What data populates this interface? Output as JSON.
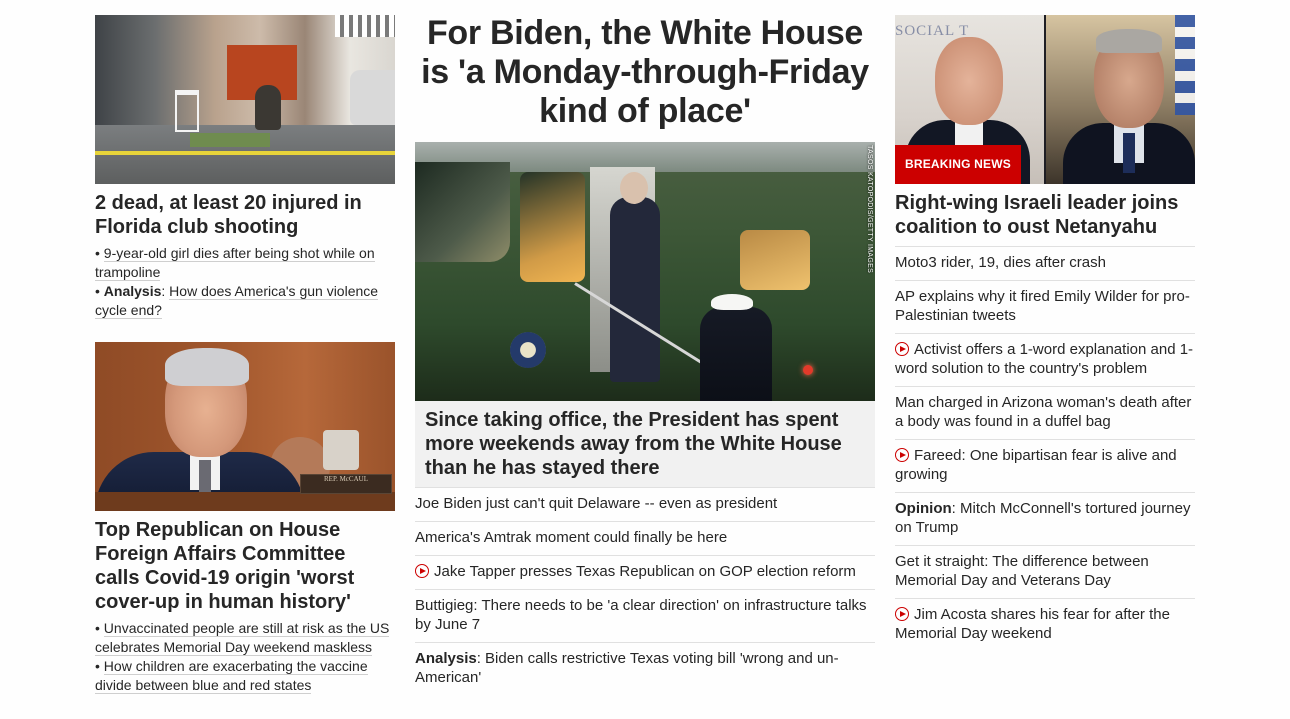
{
  "left": {
    "story1": {
      "headline": "2 dead, at least 20 injured in Florida club shooting",
      "bullets": [
        {
          "prefix": "",
          "text": "9-year-old girl dies after being shot while on trampoline"
        },
        {
          "prefix": "Analysis",
          "text": "How does America's gun violence cycle end?"
        }
      ]
    },
    "story2": {
      "headline": "Top Republican on House Foreign Affairs Committee calls Covid-19 origin 'worst cover-up in human history'",
      "nameplate": "REP. McCAUL",
      "bullets": [
        {
          "prefix": "",
          "text": "Unvaccinated people are still at risk as the US celebrates Memorial Day weekend maskless"
        },
        {
          "prefix": "",
          "text": "How children are exacerbating the vaccine divide between blue and red states"
        }
      ]
    }
  },
  "middle": {
    "title": "For Biden, the White House is 'a Monday-through-Friday kind of place'",
    "image_credit": "TASOS KATOPODIS/GETTY IMAGES",
    "caption": "Since taking office, the President has spent more weekends away from the White House than he has stayed there",
    "list": [
      {
        "video": false,
        "prefix": "",
        "text": "Joe Biden just can't quit Delaware -- even as president"
      },
      {
        "video": false,
        "prefix": "",
        "text": "America's Amtrak moment could finally be here"
      },
      {
        "video": true,
        "prefix": "",
        "text": "Jake Tapper presses Texas Republican on GOP election reform"
      },
      {
        "video": false,
        "prefix": "",
        "text": "Buttigieg: There needs to be 'a clear direction' on infrastructure talks by June 7"
      },
      {
        "video": false,
        "prefix": "Analysis",
        "text": "Biden calls restrictive Texas voting bill 'wrong and un-American'"
      }
    ]
  },
  "right": {
    "badge": "BREAKING NEWS",
    "sign_text": "SOCIAL T",
    "headline": "Right-wing Israeli leader joins coalition to oust Netanyahu",
    "list": [
      {
        "video": false,
        "prefix": "",
        "text": "Moto3 rider, 19, dies after crash"
      },
      {
        "video": false,
        "prefix": "",
        "text": "AP explains why it fired Emily Wilder for pro-Palestinian tweets"
      },
      {
        "video": true,
        "prefix": "",
        "text": "Activist offers a 1-word explanation and 1-word solution to the country's problem"
      },
      {
        "video": false,
        "prefix": "",
        "text": "Man charged in Arizona woman's death after a body was found in a duffel bag"
      },
      {
        "video": true,
        "prefix": "",
        "text": "Fareed: One bipartisan fear is alive and growing"
      },
      {
        "video": false,
        "prefix": "Opinion",
        "text": "Mitch McConnell's tortured journey on Trump"
      },
      {
        "video": false,
        "prefix": "",
        "text": "Get it straight: The difference between Memorial Day and Veterans Day"
      },
      {
        "video": true,
        "prefix": "",
        "text": "Jim Acosta shares his fear for after the Memorial Day weekend"
      }
    ]
  },
  "colors": {
    "accent": "#cc0000",
    "text": "#262626",
    "caption_bg": "#f1f1f1",
    "divider": "#e0e0e0"
  },
  "icons": {
    "video": "play-circle-icon"
  }
}
